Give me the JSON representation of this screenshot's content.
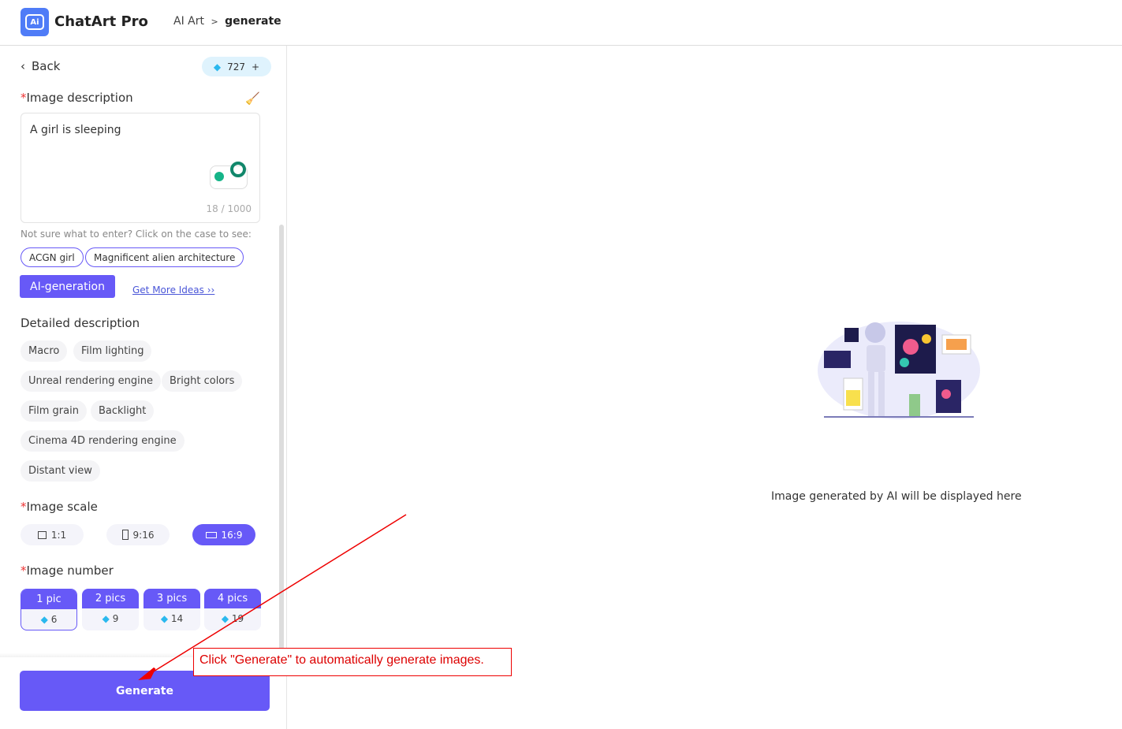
{
  "header": {
    "brand": "ChatArt Pro",
    "logo_text": "Ai",
    "crumb_parent": "AI Art",
    "crumb_sep": ">",
    "crumb_current": "generate"
  },
  "panel": {
    "back": "Back",
    "gems": "727",
    "gems_plus": "+",
    "desc_label": "Image description",
    "desc_value": "A girl is sleeping",
    "counter": "18 / 1000",
    "hint": "Not sure what to enter? Click on the case to see:",
    "cases": [
      "ACGN girl",
      "Magnificent alien architecture"
    ],
    "ai_generation": "AI-generation",
    "more_ideas": "Get More Ideas ››",
    "detail_label": "Detailed description",
    "tags": [
      [
        "Macro",
        "Film lighting"
      ],
      [
        "Unreal rendering engine",
        "Bright colors"
      ],
      [
        "Film grain",
        "Backlight"
      ],
      [
        "Cinema 4D rendering engine"
      ],
      [
        "Distant view"
      ]
    ],
    "scale_label": "Image scale",
    "scales": [
      "1:1",
      "9:16",
      "16:9"
    ],
    "scale_selected": "16:9",
    "number_label": "Image number",
    "numbers": [
      {
        "label": "1 pic",
        "cost": "6"
      },
      {
        "label": "2 pics",
        "cost": "9"
      },
      {
        "label": "3 pics",
        "cost": "14"
      },
      {
        "label": "4 pics",
        "cost": "19"
      }
    ],
    "number_selected": "1 pic",
    "generate": "Generate"
  },
  "main": {
    "empty_text": "Image generated by AI will be displayed here"
  },
  "annotation": {
    "text": "Click \"Generate\" to automatically generate images."
  },
  "colors": {
    "accent": "#6759f7",
    "annotation": "#e00000"
  }
}
